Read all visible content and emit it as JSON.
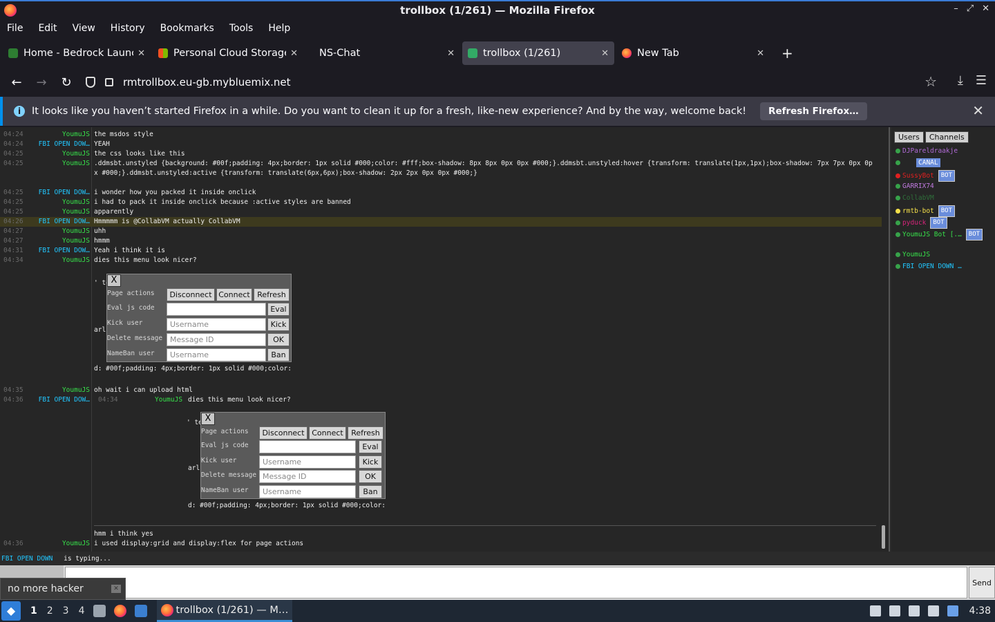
{
  "window": {
    "title": "trollbox (1/261) — Mozilla Firefox"
  },
  "menu": [
    "File",
    "Edit",
    "View",
    "History",
    "Bookmarks",
    "Tools",
    "Help"
  ],
  "tabs": [
    {
      "label": "Home - Bedrock Launche",
      "icon": "bedrock-icon",
      "active": false
    },
    {
      "label": "Personal Cloud Storage -",
      "icon": "windows-grid-icon",
      "active": false
    },
    {
      "label": "NS-Chat",
      "icon": "",
      "active": false
    },
    {
      "label": "trollbox (1/261)",
      "icon": "trollbox-icon",
      "active": true
    },
    {
      "label": "New Tab",
      "icon": "firefox-icon",
      "active": false
    }
  ],
  "url": "rmtrollbox.eu-gb.mybluemix.net",
  "notification": {
    "message": "It looks like you haven’t started Firefox in a while. Do you want to clean it up for a fresh, like-new experience? And by the way, welcome back!",
    "button": "Refresh Firefox…"
  },
  "chat": {
    "lines": [
      {
        "ts": "04:24",
        "nick": "YoumuJS",
        "text": "the msdos style"
      },
      {
        "ts": "04:24",
        "nick": "FBI OPEN DOW…",
        "text": "YEAH"
      },
      {
        "ts": "04:25",
        "nick": "YoumuJS",
        "text": "the css looks like this"
      },
      {
        "ts": "04:25",
        "nick": "YoumuJS",
        "text": ".ddmsbt.unstyled {background: #00f;padding: 4px;border: 1px solid #000;color: #fff;box-shadow: 8px 8px 0px 0px #000;}.ddmsbt.unstyled:hover {transform: translate(1px,1px);box-shadow: 7px 7px 0px 0px #000;}.ddmsbt.unstyled:active {transform: translate(6px,6px);box-shadow: 2px 2px 0px 0px #000;}"
      },
      {
        "ts": "04:25",
        "nick": "FBI OPEN DOW…",
        "text": "i wonder how you packed it inside onclick"
      },
      {
        "ts": "04:25",
        "nick": "YoumuJS",
        "text": "i had to pack it inside onclick because :active styles are banned"
      },
      {
        "ts": "04:25",
        "nick": "YoumuJS",
        "text": "apparently"
      },
      {
        "ts": "04:26",
        "nick": "FBI OPEN DOW…",
        "text": "Hmmmmm is @CollabVM actually CollabVM"
      },
      {
        "ts": "04:27",
        "nick": "YoumuJS",
        "text": "uhh"
      },
      {
        "ts": "04:27",
        "nick": "YoumuJS",
        "text": "hmmm"
      },
      {
        "ts": "04:31",
        "nick": "FBI OPEN DOW…",
        "text": "Yeah i think it is"
      },
      {
        "ts": "04:34",
        "nick": "YoumuJS",
        "text": "dies this menu look nicer?"
      },
      {
        "ts": "04:35",
        "nick": "YoumuJS",
        "text": "oh wait i can upload html"
      },
      {
        "ts": "04:36",
        "nick": "FBI OPEN DOW…",
        "text": ""
      },
      {
        "ts": "04:36",
        "nick": "YoumuJS",
        "text": "i used display:grid and display:flex for page actions"
      }
    ],
    "pre_last_text": "hmm i think yes",
    "quote": {
      "ts": "04:34",
      "nick": "YoumuJS",
      "text": "dies this menu look nicer?"
    },
    "snippets": {
      "te": "' te",
      "arl": "arl",
      "css_tail": "d: #00f;padding: 4px;border: 1px solid #000;color:"
    },
    "panel": {
      "close": "X",
      "page_actions": "Page actions",
      "disconnect": "Disconnect",
      "connect": "Connect",
      "refresh": "Refresh",
      "eval_label": "Eval js code",
      "eval_btn": "Eval",
      "kick_label": "Kick user",
      "kick_placeholder": "Username",
      "kick_btn": "Kick",
      "delete_label": "Delete message",
      "delete_placeholder": "Message ID",
      "delete_btn": "OK",
      "ban_label": "NameBan user",
      "ban_placeholder": "Username",
      "ban_btn": "Ban"
    }
  },
  "sidebar": {
    "tab_users": "Users",
    "tab_channels": "Channels",
    "users": [
      {
        "name": "DJPareldraakje",
        "color": "#b06ad6",
        "dot": "#37a34a",
        "badge": ""
      },
      {
        "name": "CANAL",
        "color": "#1a56d6",
        "dot": "#37a34a",
        "badge": "",
        "boxed": true
      },
      {
        "name": "SussyBot",
        "color": "#e02020",
        "dot": "#e02020",
        "badge": "BOT"
      },
      {
        "name": "GARRIX74",
        "color": "#c07adf",
        "dot": "#37a34a",
        "badge": ""
      },
      {
        "name": "CollabVM",
        "color": "#2f6f3a",
        "dot": "#37a34a",
        "badge": ""
      },
      {
        "name": "rmtb-bot",
        "color": "#f5e04a",
        "dot": "#f5e04a",
        "badge": "BOT"
      },
      {
        "name": "pyduck",
        "color": "#d6247a",
        "dot": "#37a34a",
        "badge": "BOT"
      },
      {
        "name": "YoumuJS Bot [.…",
        "color": "#37e14a",
        "dot": "#37a34a",
        "badge": "BOT"
      },
      {
        "name": "YoumuJS",
        "color": "#37e14a",
        "dot": "#37a34a",
        "badge": ""
      },
      {
        "name": "FBI OPEN DOWN …",
        "color": "#21c7ff",
        "dot": "#37a34a",
        "badge": ""
      }
    ]
  },
  "typing": {
    "who": "FBI OPEN DOWN",
    "what": "is typing..."
  },
  "send": "Send",
  "toast": "no more hacker",
  "taskbar": {
    "workspaces": [
      "1",
      "2",
      "3",
      "4"
    ],
    "task": "trollbox (1/261) — M…",
    "clock": "4:38"
  },
  "colors": {
    "accent": "#0090ed",
    "youmu": "#37e14a",
    "fbi": "#21c7ff"
  }
}
